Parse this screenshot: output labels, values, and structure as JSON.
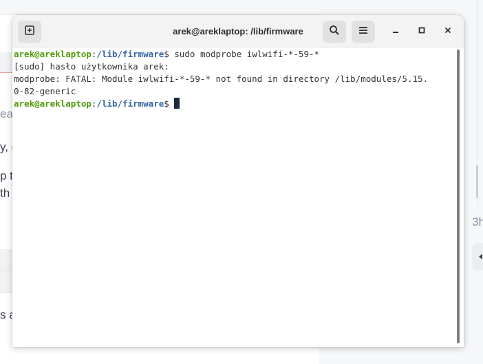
{
  "window": {
    "title": "arek@areklaptop: /lib/firmware"
  },
  "titlebar": {
    "new_tab_icon": "new-tab-icon",
    "search_icon": "search-icon",
    "menu_icon": "hamburger-menu-icon",
    "minimize_icon": "minimize-icon",
    "maximize_icon": "maximize-icon",
    "close_icon": "close-icon"
  },
  "terminal": {
    "lines": [
      {
        "user": "arek@areklaptop",
        "sep": ":",
        "path": "/lib/firmware",
        "suffix": "$ sudo modprobe iwlwifi-*-59-*"
      },
      {
        "text": "[sudo] hasło użytkownika arek:"
      },
      {
        "text": "modprobe: FATAL: Module iwlwifi-*-59-* not found in directory /lib/modules/5.15."
      },
      {
        "text": "0-82-generic"
      },
      {
        "user": "arek@areklaptop",
        "sep": ":",
        "path": "/lib/firmware",
        "suffix": "$ "
      }
    ]
  },
  "background": {
    "fragments": [
      "ea",
      "y, c",
      "p t",
      " th",
      "s a"
    ],
    "right_fragment": "3h"
  },
  "colors": {
    "prompt_user": "#4e9a06",
    "prompt_path": "#3465a4",
    "text": "#2e3436",
    "titlebar": "#f3f3f3"
  }
}
